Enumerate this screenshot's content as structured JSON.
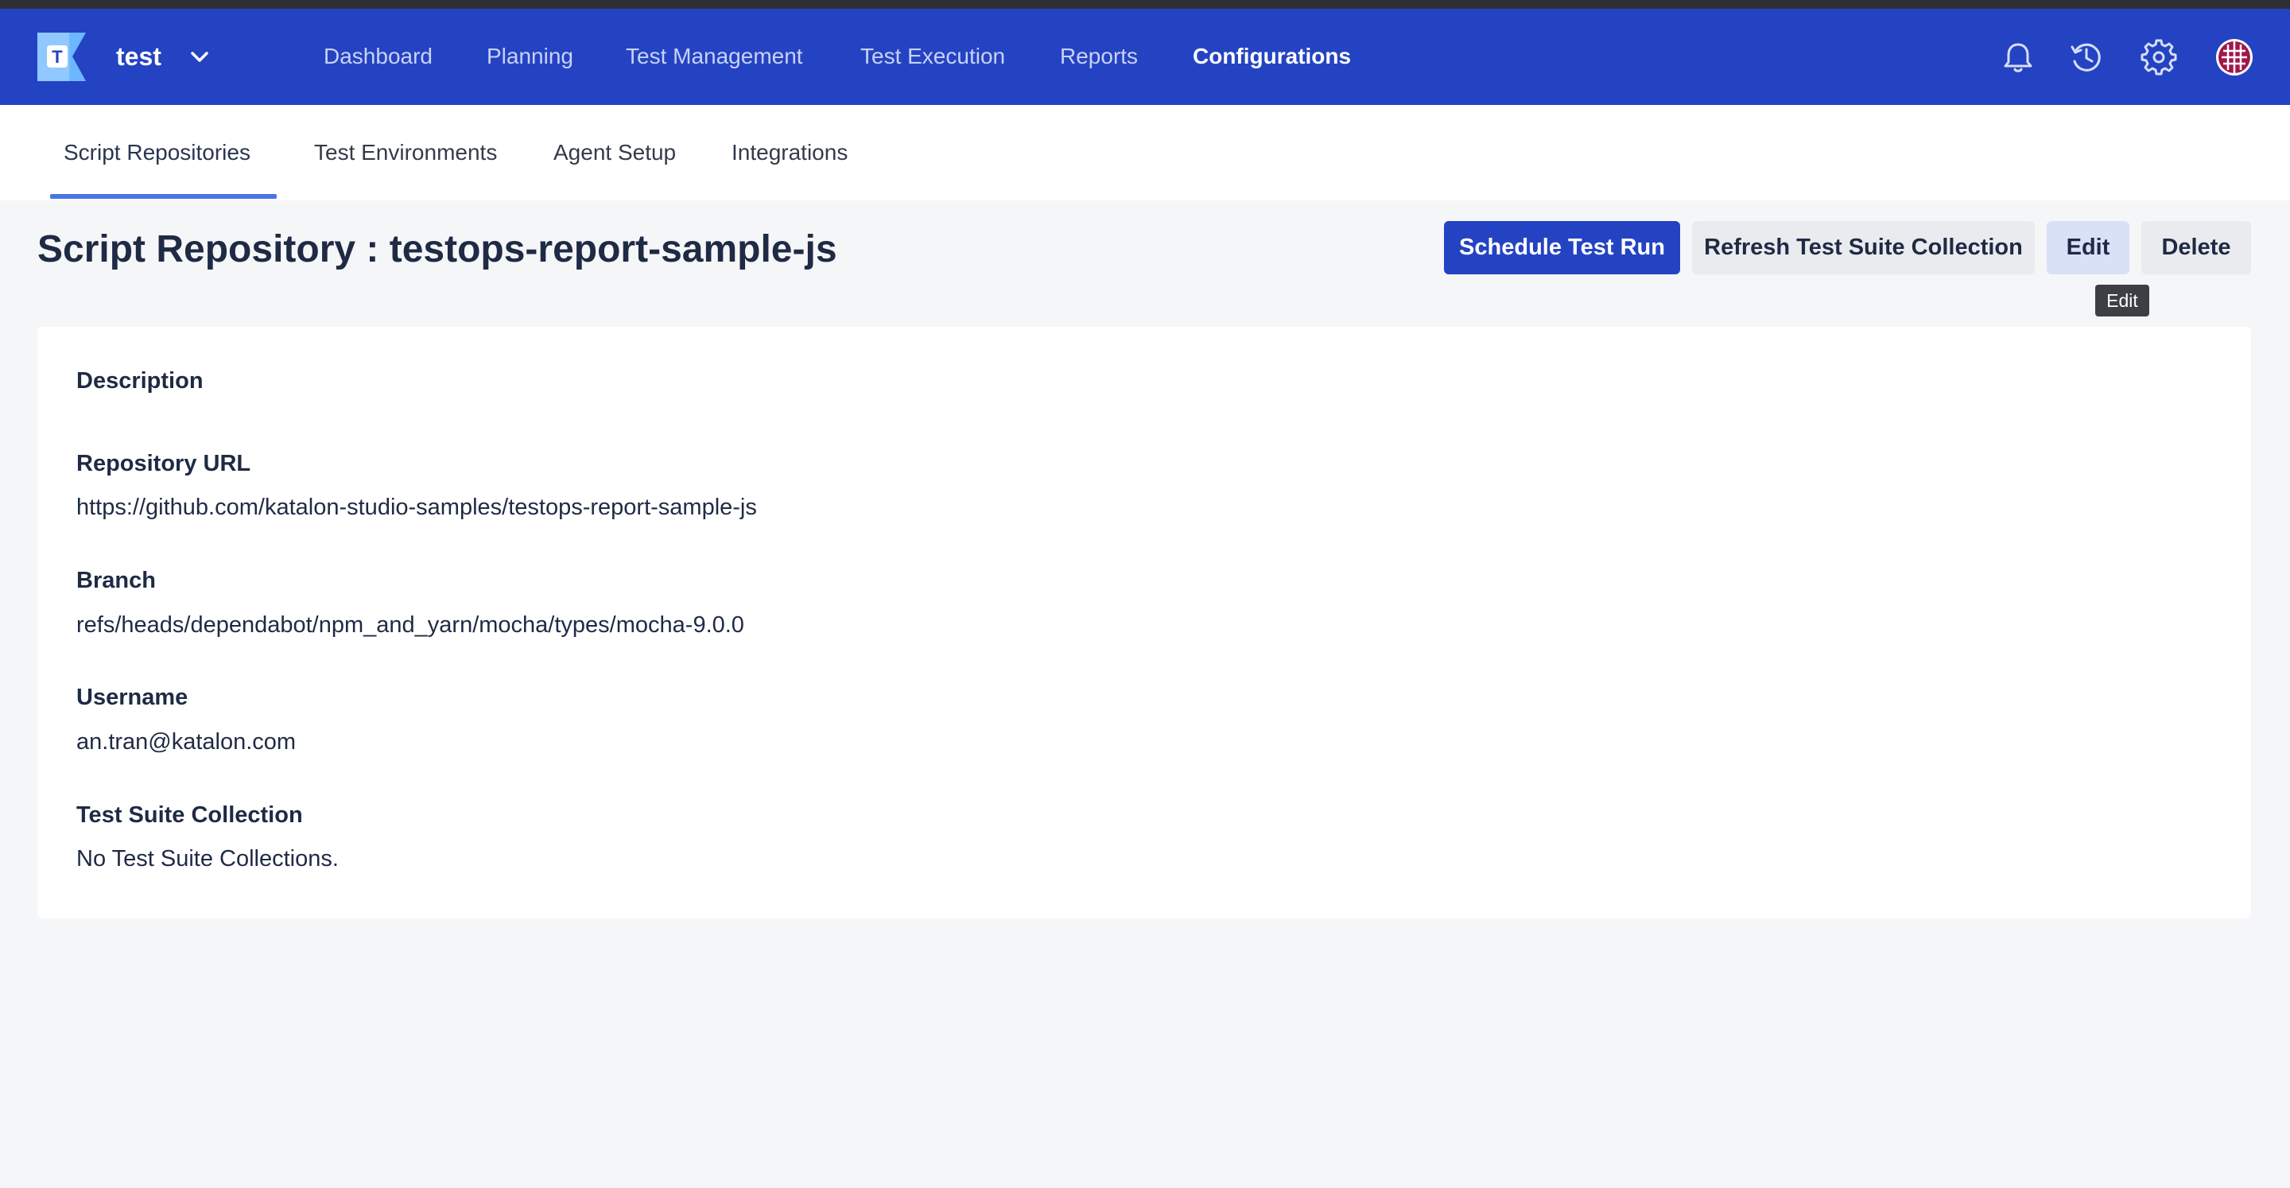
{
  "header": {
    "project_name": "test",
    "nav": [
      {
        "label": "Dashboard"
      },
      {
        "label": "Planning"
      },
      {
        "label": "Test Management"
      },
      {
        "label": "Test Execution"
      },
      {
        "label": "Reports"
      },
      {
        "label": "Configurations",
        "active": true
      }
    ],
    "icons": [
      "bell-icon",
      "history-icon",
      "gear-icon",
      "avatar"
    ]
  },
  "subnav": {
    "tabs": [
      {
        "label": "Script Repositories",
        "active": true
      },
      {
        "label": "Test Environments"
      },
      {
        "label": "Agent Setup"
      },
      {
        "label": "Integrations"
      }
    ]
  },
  "page": {
    "title": "Script Repository : testops-report-sample-js",
    "actions": {
      "schedule": "Schedule Test Run",
      "refresh": "Refresh Test Suite Collection",
      "edit": "Edit",
      "delete": "Delete"
    },
    "tooltip": "Edit"
  },
  "details": {
    "description_label": "Description",
    "repository_url_label": "Repository URL",
    "repository_url": "https://github.com/katalon-studio-samples/testops-report-sample-js",
    "branch_label": "Branch",
    "branch": "refs/heads/dependabot/npm_and_yarn/mocha/types/mocha-9.0.0",
    "username_label": "Username",
    "username": "an.tran@katalon.com",
    "tsc_label": "Test Suite Collection",
    "tsc_value": "No Test Suite Collections."
  },
  "colors": {
    "brand": "#2443c3",
    "accent_underline": "#4a74e6",
    "page_bg": "#f5f6f8"
  }
}
